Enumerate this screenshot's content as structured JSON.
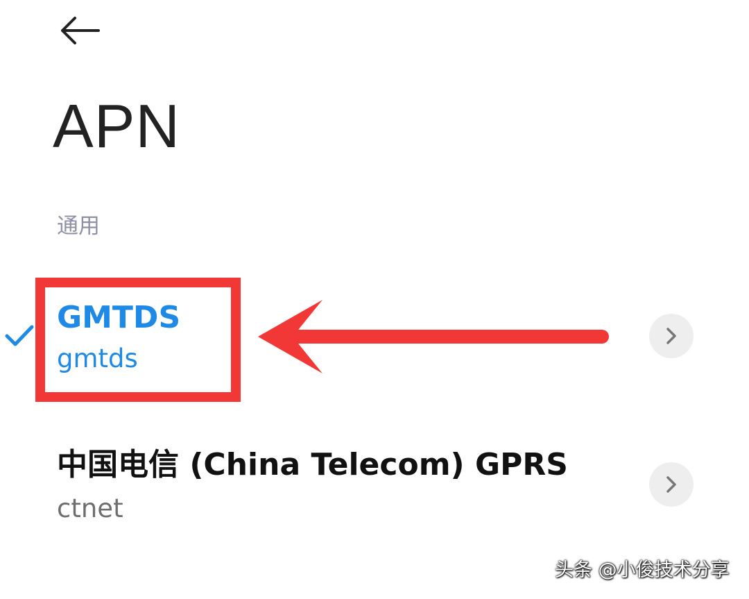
{
  "header": {
    "back_icon": "arrow-left-icon",
    "title": "APN"
  },
  "section": {
    "label": "通用"
  },
  "apns": [
    {
      "name": "GMTDS",
      "apn": "gmtds",
      "selected": true,
      "accent": "#1f8ae6"
    },
    {
      "name": "中国电信 (China Telecom) GPRS",
      "apn": "ctnet",
      "selected": false
    }
  ],
  "annotation": {
    "color": "#f23737"
  },
  "watermark": "头条 @小俊技术分享"
}
